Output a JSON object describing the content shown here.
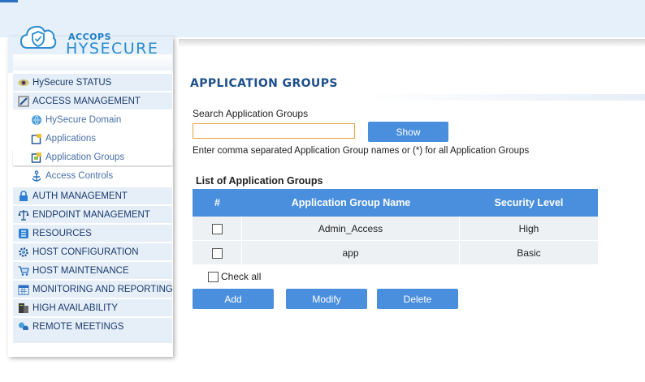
{
  "logo": {
    "brand_top": "ACCOPS",
    "brand_bottom": "HYSECURE"
  },
  "sidebar": {
    "items": [
      {
        "label": "HySecure STATUS",
        "icon": "status-eye-icon",
        "level": "top"
      },
      {
        "label": "ACCESS MANAGEMENT",
        "icon": "access-management-icon",
        "level": "top"
      },
      {
        "label": "HySecure Domain",
        "icon": "domain-globe-icon",
        "level": "sub"
      },
      {
        "label": "Applications",
        "icon": "applications-icon",
        "level": "sub"
      },
      {
        "label": "Application Groups",
        "icon": "application-groups-icon",
        "level": "sub",
        "active": true
      },
      {
        "label": "Access Controls",
        "icon": "anchor-icon",
        "level": "sub"
      },
      {
        "label": "AUTH MANAGEMENT",
        "icon": "lock-icon",
        "level": "top"
      },
      {
        "label": "ENDPOINT MANAGEMENT",
        "icon": "scale-icon",
        "level": "top"
      },
      {
        "label": "RESOURCES",
        "icon": "resources-grid-icon",
        "level": "top"
      },
      {
        "label": "HOST CONFIGURATION",
        "icon": "gear-icon",
        "level": "top"
      },
      {
        "label": "HOST MAINTENANCE",
        "icon": "cart-icon",
        "level": "top"
      },
      {
        "label": "MONITORING AND REPORTING",
        "icon": "calendar-icon",
        "level": "top"
      },
      {
        "label": "HIGH AVAILABILITY",
        "icon": "server-icon",
        "level": "top"
      },
      {
        "label": "REMOTE MEETINGS",
        "icon": "meetings-icon",
        "level": "top"
      }
    ]
  },
  "main": {
    "title": "APPLICATION GROUPS",
    "search": {
      "label": "Search Application Groups",
      "value": "",
      "show_label": "Show",
      "hint": "Enter comma separated Application Group names or (*) for all Application Groups"
    },
    "list": {
      "title": "List of Application Groups",
      "columns": [
        "#",
        "Application Group Name",
        "Security Level"
      ],
      "rows": [
        {
          "name": "Admin_Access",
          "level": "High",
          "checked": false
        },
        {
          "name": "app",
          "level": "Basic",
          "checked": false
        }
      ]
    },
    "check_all_label": "Check all",
    "buttons": {
      "add": "Add",
      "modify": "Modify",
      "delete": "Delete"
    }
  },
  "colors": {
    "accent": "#4a8fdd",
    "title": "#1d4f8c",
    "menu_bg": "#e6eef7",
    "header_bg": "#e6f0fa",
    "input_border": "#e8a33d",
    "row_bg": "#eef1f4"
  }
}
